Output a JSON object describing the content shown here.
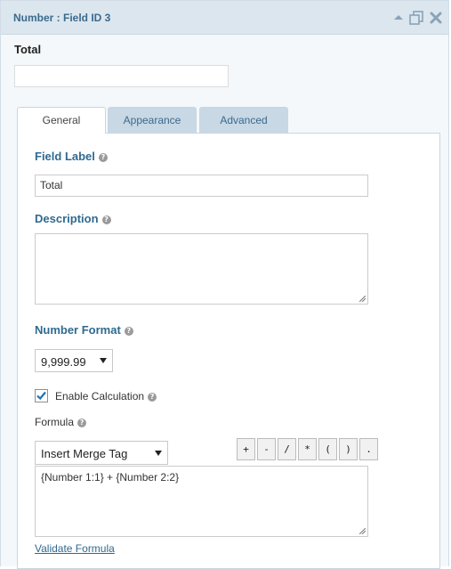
{
  "header": {
    "title": "Number : Field ID 3",
    "icons": [
      "collapse-arrow-icon",
      "duplicate-icon",
      "delete-icon"
    ]
  },
  "preview": {
    "label": "Total",
    "value": ""
  },
  "tabs": [
    {
      "label": "General",
      "active": true
    },
    {
      "label": "Appearance",
      "active": false
    },
    {
      "label": "Advanced",
      "active": false
    }
  ],
  "general": {
    "field_label": {
      "label": "Field Label",
      "help": "?",
      "value": "Total"
    },
    "description": {
      "label": "Description",
      "help": "?",
      "value": ""
    },
    "number_format": {
      "label": "Number Format",
      "help": "?",
      "value": "9,999.99"
    },
    "enable_calculation": {
      "label": "Enable Calculation",
      "help": "?",
      "checked": true
    },
    "formula": {
      "label": "Formula",
      "help": "?",
      "merge_tag": "Insert Merge Tag",
      "operators": [
        "+",
        "-",
        "/",
        "*",
        "(",
        ")",
        "."
      ],
      "value": "{Number 1:1} + {Number 2:2}",
      "validate_link": "Validate Formula"
    }
  },
  "colors": {
    "accent": "#2f6a8f",
    "header_bg": "#dce6ee",
    "tab_inactive_bg": "#c8d8e4",
    "checkmark": "#2271b1"
  }
}
